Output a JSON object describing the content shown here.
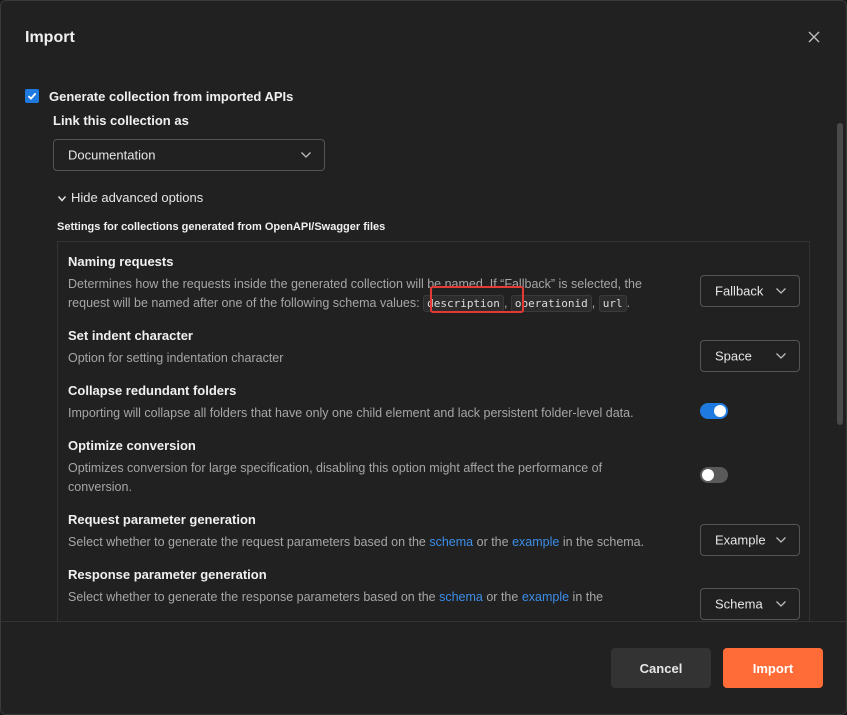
{
  "dialog": {
    "title": "Import",
    "generate_collection_label": "Generate collection from imported APIs",
    "link_collection_label": "Link this collection as",
    "link_collection_value": "Documentation",
    "advanced_toggle_label": "Hide advanced options",
    "settings_heading": "Settings for collections generated from OpenAPI/Swagger files"
  },
  "settings": {
    "naming": {
      "title": "Naming requests",
      "desc_line1": "Determines how the requests inside the generated collection will be named. If “Fallback” is selected, the",
      "desc_line2": "request will be named after one of the following schema values:",
      "codes": [
        "description",
        "operationid",
        "url"
      ],
      "value": "Fallback"
    },
    "indent": {
      "title": "Set indent character",
      "desc": "Option for setting indentation character",
      "value": "Space"
    },
    "collapse": {
      "title": "Collapse redundant folders",
      "desc": "Importing will collapse all folders that have only one child element and lack persistent folder-level data.",
      "enabled": true
    },
    "optimize": {
      "title": "Optimize conversion",
      "desc": "Optimizes conversion for large specification, disabling this option might affect the performance of conversion.",
      "enabled": false
    },
    "request_param": {
      "title": "Request parameter generation",
      "desc_prefix": "Select whether to generate the request parameters based on the",
      "link_schema": "schema",
      "or_the": "or the",
      "link_example": "example",
      "desc_suffix": "in the schema.",
      "value": "Example"
    },
    "response_param": {
      "title": "Response parameter generation",
      "desc_prefix": "Select whether to generate the response parameters based on the",
      "link_schema": "schema",
      "or_the": "or the",
      "link_example": "example",
      "desc_suffix": "in the",
      "value": "Schema"
    }
  },
  "footer": {
    "cancel_label": "Cancel",
    "import_label": "Import"
  },
  "colors": {
    "accent": "#ff6c37",
    "link": "#3b8eea",
    "toggle_on": "#1f7ae0",
    "highlight": "#e53935"
  }
}
